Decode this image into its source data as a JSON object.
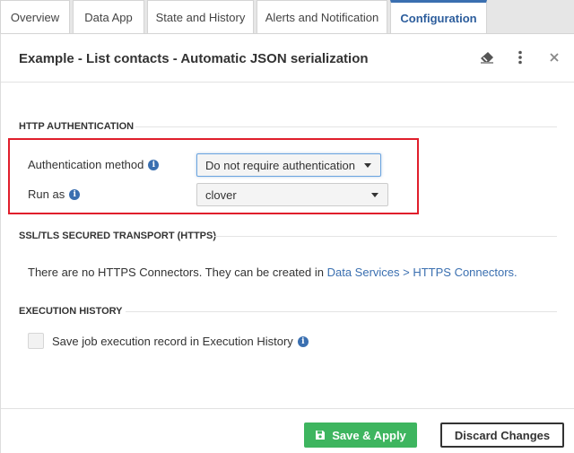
{
  "tabs": [
    {
      "label": "Overview"
    },
    {
      "label": "Data App"
    },
    {
      "label": "State and History"
    },
    {
      "label": "Alerts and Notification"
    },
    {
      "label": "Configuration",
      "active": true
    }
  ],
  "header": {
    "title": "Example - List contacts - Automatic JSON serialization",
    "icons": [
      "eraser-icon",
      "more-vertical-icon",
      "close-icon"
    ]
  },
  "http_auth": {
    "section_title": "HTTP AUTHENTICATION",
    "auth_method_label": "Authentication method",
    "auth_method_value": "Do not require authentication",
    "run_as_label": "Run as",
    "run_as_value": "clover"
  },
  "ssl": {
    "section_title": "SSL/TLS SECURED TRANSPORT (HTTPS)",
    "message": "There are no HTTPS Connectors. They can be created in ",
    "link_text": "Data Services > HTTPS Connectors."
  },
  "execution_history": {
    "section_title": "EXECUTION HISTORY",
    "checkbox_label": "Save job execution record in Execution History",
    "checked": false
  },
  "footer": {
    "save_label": "Save & Apply",
    "discard_label": "Discard Changes"
  },
  "colors": {
    "accent": "#3a6fb0",
    "save_green": "#3eb55f",
    "highlight_red": "#e01e2b"
  }
}
